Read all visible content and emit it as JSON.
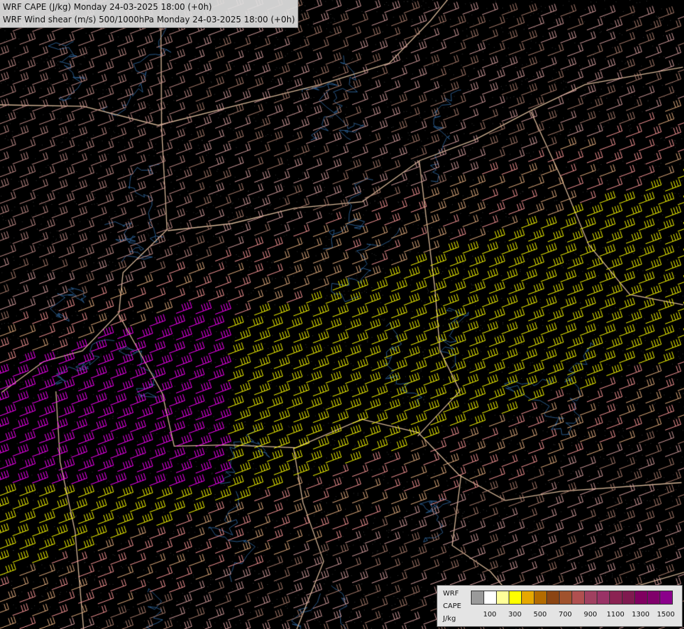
{
  "title_lines": [
    "WRF CAPE (J/kg) Monday 24-03-2025 18:00 (+0h)",
    "WRF Wind shear (m/s) 500/1000hPa Monday 24-03-2025 18:00 (+0h)"
  ],
  "legend": {
    "labels": [
      "WRF",
      "CAPE",
      "J/kg"
    ],
    "swatch_colors": [
      "#9a9a9a",
      "#ffffff",
      "#ffff99",
      "#ffff00",
      "#e6a800",
      "#b36b00",
      "#8b4513",
      "#a0522d",
      "#b05050",
      "#a04060",
      "#993366",
      "#8b2252",
      "#7f1a4f",
      "#800060",
      "#80006a",
      "#8b008b"
    ],
    "ticks": [
      "100",
      "300",
      "500",
      "700",
      "900",
      "1100",
      "1300",
      "1500"
    ]
  },
  "colors": {
    "background": "#000000",
    "low_shear": "#d9a0a0",
    "mid_shear": "#ff9999",
    "high_shear": "#ffff00",
    "very_high_shear": "#ff00ff",
    "border": "#d8b898",
    "river": "#2a5a8a"
  }
}
